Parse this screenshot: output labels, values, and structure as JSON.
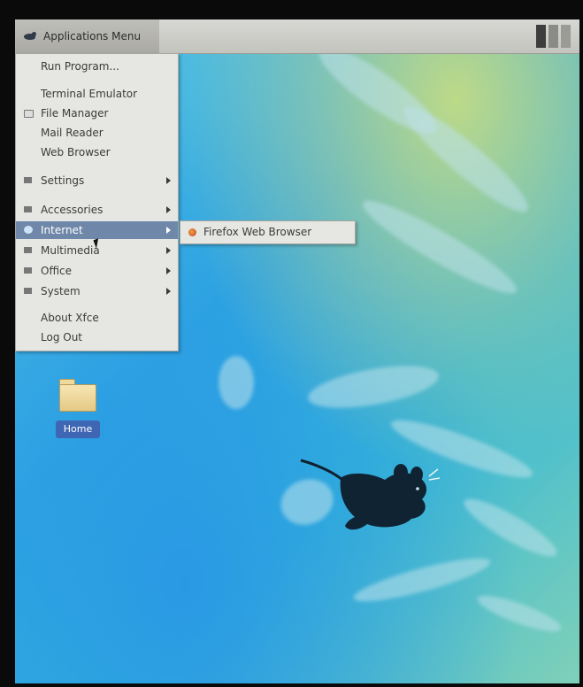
{
  "panel": {
    "apps_menu_label": "Applications Menu"
  },
  "apps_menu": {
    "items": [
      {
        "label": "Run Program...",
        "icon": "none",
        "has_submenu": false
      },
      {
        "label": "Terminal Emulator",
        "icon": "none",
        "has_submenu": false
      },
      {
        "label": "File Manager",
        "icon": "folder-icon",
        "has_submenu": false
      },
      {
        "label": "Mail Reader",
        "icon": "none",
        "has_submenu": false
      },
      {
        "label": "Web Browser",
        "icon": "none",
        "has_submenu": false
      },
      {
        "label": "Settings",
        "icon": "category-icon",
        "has_submenu": true
      },
      {
        "label": "Accessories",
        "icon": "category-icon",
        "has_submenu": true
      },
      {
        "label": "Internet",
        "icon": "globe-icon",
        "has_submenu": true,
        "active": true
      },
      {
        "label": "Multimedia",
        "icon": "category-icon",
        "has_submenu": true
      },
      {
        "label": "Office",
        "icon": "category-icon",
        "has_submenu": true
      },
      {
        "label": "System",
        "icon": "category-icon",
        "has_submenu": true
      },
      {
        "label": "About Xfce",
        "icon": "none",
        "has_submenu": false
      },
      {
        "label": "Log Out",
        "icon": "none",
        "has_submenu": false
      }
    ]
  },
  "internet_submenu": {
    "items": [
      {
        "label": "Firefox Web Browser",
        "icon": "firefox-icon"
      }
    ]
  },
  "desktop": {
    "home_icon_label": "Home"
  },
  "colors": {
    "menu_bg": "#e6e6e2",
    "highlight": "#6f87a8",
    "panel_bg": "#cfcfcb",
    "desktop_blue": "#2fa8e0"
  }
}
